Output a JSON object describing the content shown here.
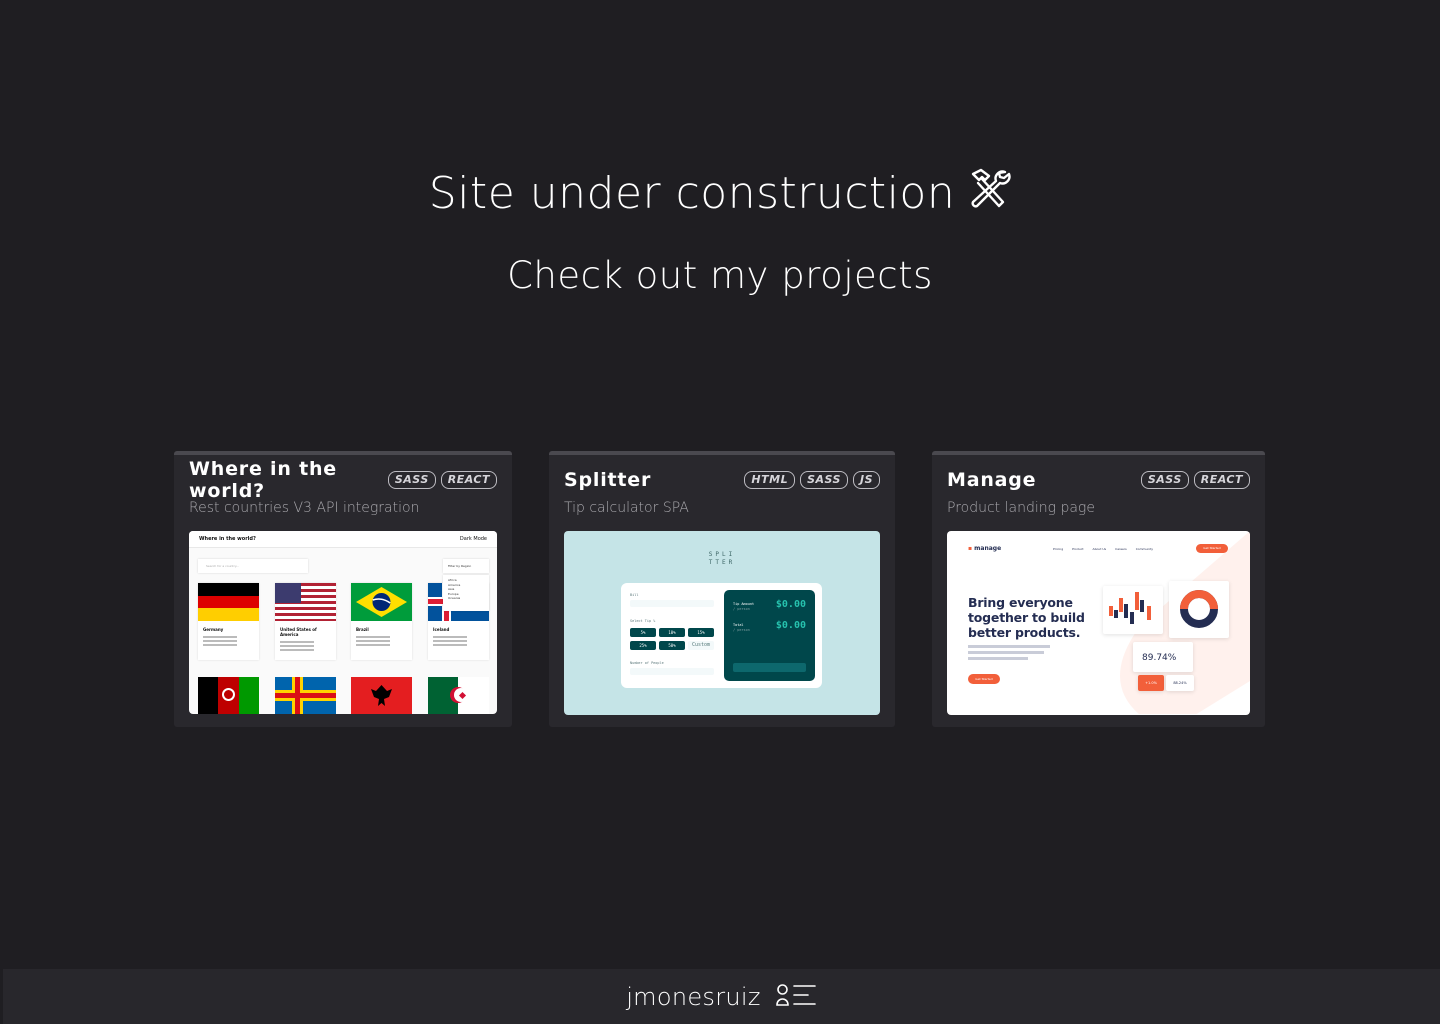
{
  "hero": {
    "title": "Site under construction",
    "title_icon": "hammer-and-wrench-icon",
    "subtitle": "Check out my projects"
  },
  "projects": [
    {
      "title": "Where in the world?",
      "tags": [
        "SASS",
        "REACT"
      ],
      "description": "Rest countries V3 API integration",
      "thumbnail": {
        "app_title": "Where in the world?",
        "dark_mode": "Dark Mode",
        "search_placeholder": "Search for a country...",
        "filter_label": "Filter by Region",
        "regions": [
          "Africa",
          "America",
          "Asia",
          "Europe",
          "Oceania"
        ],
        "countries": [
          "Germany",
          "United States of America",
          "Brazil",
          "Iceland"
        ]
      }
    },
    {
      "title": "Splitter",
      "tags": [
        "HTML",
        "SASS",
        "JS"
      ],
      "description": "Tip calculator SPA",
      "thumbnail": {
        "logo_line1": "SPLI",
        "logo_line2": "TTER",
        "bill_label": "Bill",
        "tip_label": "Select Tip %",
        "tips": [
          "5%",
          "10%",
          "15%",
          "25%",
          "50%"
        ],
        "custom": "Custom",
        "people_label": "Number of People",
        "tip_amount_label": "Tip Amount",
        "total_label": "Total",
        "per_person": "/ person",
        "tip_amount_value": "$0.00",
        "total_value": "$0.00"
      }
    },
    {
      "title": "Manage",
      "tags": [
        "SASS",
        "REACT"
      ],
      "description": "Product landing page",
      "thumbnail": {
        "logo": "manage",
        "nav_links": [
          "Pricing",
          "Product",
          "About Us",
          "Careers",
          "Community"
        ],
        "cta": "Get Started",
        "headline": "Bring everyone together to build better products.",
        "stat_main": "89.74%",
        "stat_small_a": "+1.0%",
        "stat_small_b": "88.24%"
      }
    }
  ],
  "footer": {
    "name": "jmonesruiz",
    "logo_icon": "person-menu-icon"
  },
  "colors": {
    "background": "#1f1e22",
    "card": "#29282d",
    "footer": "#28272c",
    "text": "#ffffff",
    "muted": "#a9a8ad"
  }
}
